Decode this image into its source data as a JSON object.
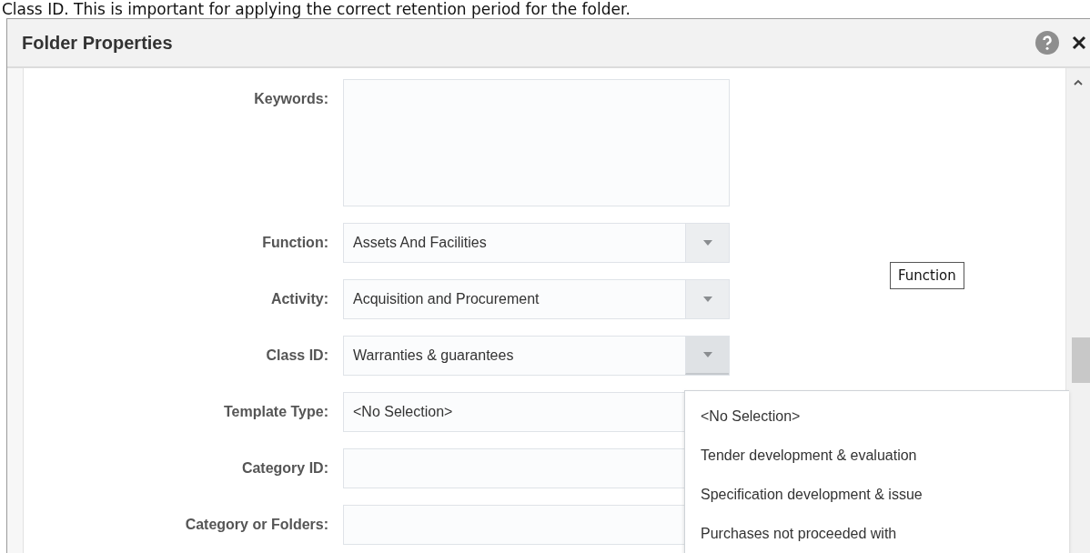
{
  "caption": "Class ID. This is important for applying the correct retention period for the folder.",
  "dialog": {
    "title": "Folder Properties"
  },
  "fields": [
    {
      "kind": "textarea",
      "label": "Keywords:"
    },
    {
      "kind": "select",
      "label": "Function:",
      "value": "Assets And Facilities",
      "expanded": false
    },
    {
      "kind": "select",
      "label": "Activity:",
      "value": "Acquisition and Procurement",
      "expanded": false
    },
    {
      "kind": "select",
      "label": "Class ID:",
      "value": "Warranties & guarantees",
      "expanded": true
    },
    {
      "kind": "text",
      "label": "Template Type:",
      "value": "<No Selection>"
    },
    {
      "kind": "text",
      "label": "Category ID:"
    },
    {
      "kind": "text",
      "label": "Category or Folders:"
    }
  ],
  "tooltip": "Function",
  "dropdown": {
    "options": [
      "<No Selection>",
      "Tender development & evaluation",
      "Specification development & issue",
      "Purchases not proceeded with"
    ]
  }
}
